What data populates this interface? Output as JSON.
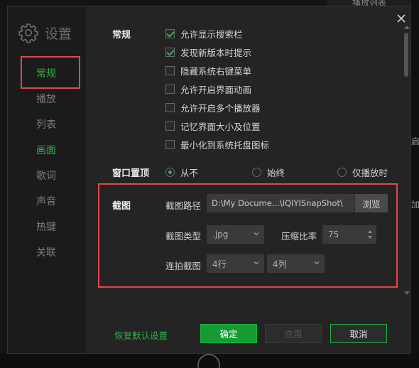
{
  "background": {
    "top_tab": "播放列表",
    "peek_right": [
      "启",
      "加"
    ]
  },
  "sidebar": {
    "title": "设置",
    "items": [
      {
        "label": "常规",
        "state": "active"
      },
      {
        "label": "播放",
        "state": "normal"
      },
      {
        "label": "列表",
        "state": "normal"
      },
      {
        "label": "画面",
        "state": "green"
      },
      {
        "label": "歌词",
        "state": "normal"
      },
      {
        "label": "声音",
        "state": "normal"
      },
      {
        "label": "热键",
        "state": "normal"
      },
      {
        "label": "关联",
        "state": "normal"
      }
    ]
  },
  "general": {
    "section_label": "常规",
    "options": [
      {
        "label": "允许显示搜索栏",
        "checked": true
      },
      {
        "label": "发现新版本时提示",
        "checked": true
      },
      {
        "label": "隐藏系统右键菜单",
        "checked": false
      },
      {
        "label": "允许开启界面动画",
        "checked": false
      },
      {
        "label": "允许开启多个播放器",
        "checked": false
      },
      {
        "label": "记忆界面大小及位置",
        "checked": false
      },
      {
        "label": "最小化到系统托盘图标",
        "checked": false
      }
    ]
  },
  "topmost": {
    "section_label": "窗口置顶",
    "options": [
      {
        "label": "从不",
        "selected": true
      },
      {
        "label": "始终",
        "selected": false
      },
      {
        "label": "仅播放时",
        "selected": false
      }
    ]
  },
  "screenshot": {
    "section_label": "截图",
    "path_label": "截图路径",
    "path_value": "D:\\My Docume...\\IQIYISnapShot\\",
    "browse_label": "浏览",
    "type_label": "截图类型",
    "type_value": ".jpg",
    "ratio_label": "压缩比率",
    "ratio_value": "75",
    "burst_label": "连拍截图",
    "rows_value": "4行",
    "cols_value": "4列"
  },
  "footer": {
    "restore_label": "恢复默认设置",
    "ok_label": "确定",
    "apply_label": "应用",
    "cancel_label": "取消"
  },
  "colors": {
    "accent": "#2fb34a",
    "highlight_box": "#e04848",
    "dialog_bg": "#242424",
    "sidebar_bg": "#1b1b1b"
  },
  "icons": [
    "gear-icon",
    "close-icon",
    "checkbox-check-icon",
    "chevron-down-icon",
    "spin-up-icon",
    "spin-down-icon"
  ]
}
